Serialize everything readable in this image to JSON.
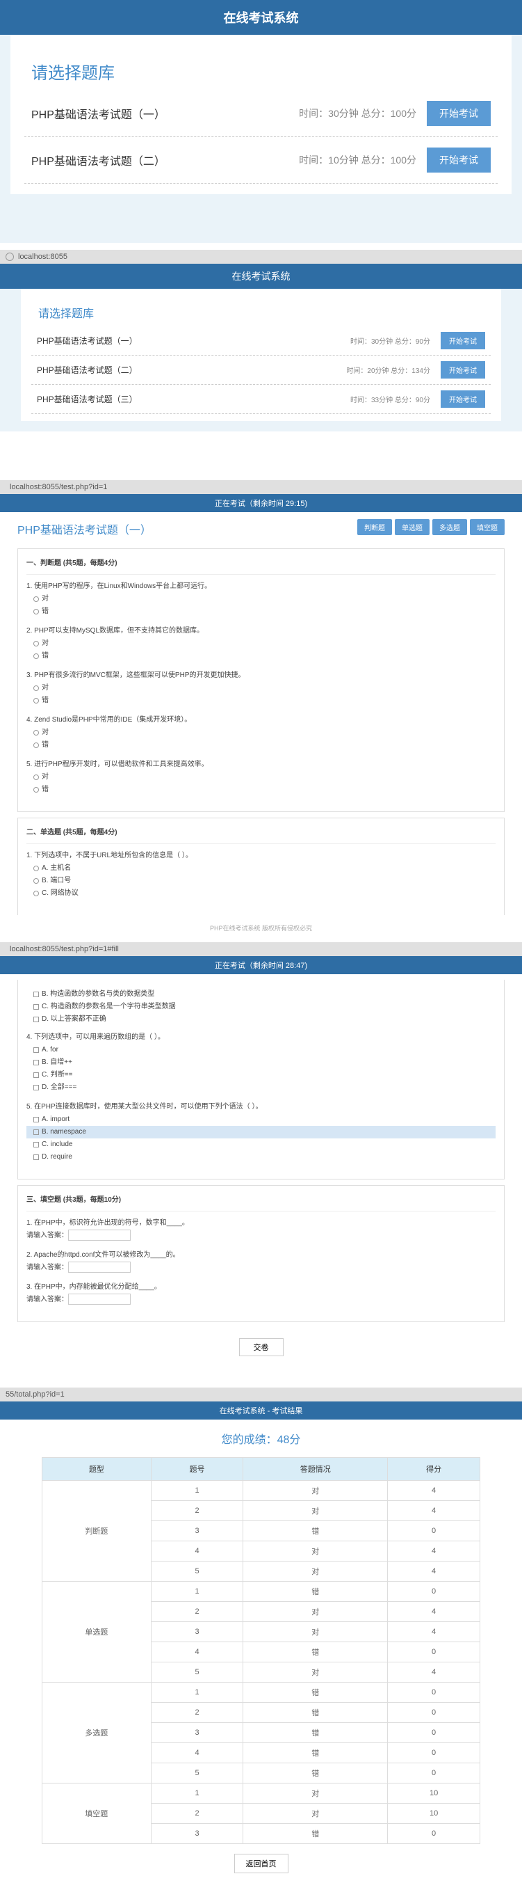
{
  "screen1": {
    "header": "在线考试系统",
    "select_title": "请选择题库",
    "exams": [
      {
        "name": "PHP基础语法考试题（一）",
        "meta": "时间：30分钟 总分：100分",
        "btn": "开始考试"
      },
      {
        "name": "PHP基础语法考试题（二）",
        "meta": "时间：10分钟 总分：100分",
        "btn": "开始考试"
      }
    ]
  },
  "screen2": {
    "url": "localhost:8055",
    "header": "在线考试系统",
    "select_title": "请选择题库",
    "exams": [
      {
        "name": "PHP基础语法考试题（一）",
        "meta": "时间：30分钟 总分：90分",
        "btn": "开始考试"
      },
      {
        "name": "PHP基础语法考试题（二）",
        "meta": "时间：20分钟 总分：134分",
        "btn": "开始考试"
      },
      {
        "name": "PHP基础语法考试题（三）",
        "meta": "时间：33分钟 总分：90分",
        "btn": "开始考试"
      }
    ]
  },
  "screen3": {
    "url": "localhost:8055/test.php?id=1",
    "header": "正在考试（剩余时间 29:15)",
    "title": "PHP基础语法考试题（一）",
    "pills": [
      "判断题",
      "单选题",
      "多选题",
      "填空题"
    ],
    "sec1_title": "一、判断题 (共5题，每题4分)",
    "q1": "1. 使用PHP写的程序，在Linux和Windows平台上都可运行。",
    "q2": "2. PHP可以支持MySQL数据库，但不支持其它的数据库。",
    "q3": "3. PHP有很多流行的MVC框架，这些框架可以使PHP的开发更加快捷。",
    "q4": "4. Zend Studio是PHP中常用的IDE（集成开发环境）。",
    "q5": "5. 进行PHP程序开发时，可以借助软件和工具来提高效率。",
    "opt_yes": "对",
    "opt_no": "错",
    "sec2_title": "二、单选题 (共5题，每题4分)",
    "mq1": "1. 下列选项中，不属于URL地址所包含的信息是（ ）。",
    "mq1_a": "A. 主机名",
    "mq1_b": "B. 端口号",
    "mq1_c": "C. 网络协议"
  },
  "screen4": {
    "url": "localhost:8055/test.php?id=1#fill",
    "header": "正在考试（剩余时间 28:47)",
    "footer_hint": "PHP在线考试系统 版权所有侵权必究",
    "l1": "B. 构造函数的参数名与类的数据类型",
    "l2": "C. 构造函数的参数名是一个字符串类型数据",
    "l3": "D. 以上答案都不正确",
    "mq4": "4. 下列选项中，可以用来遍历数组的是（ ）。",
    "mq4_a": "A. for",
    "mq4_b": "B. 自增++",
    "mq4_c": "C. 判断==",
    "mq4_d": "D. 全部===",
    "mq5": "5. 在PHP连接数据库时，使用某大型公共文件时，可以使用下列个语法（ ）。",
    "mq5_a": "A. import",
    "mq5_b": "B. namespace",
    "mq5_c": "C. include",
    "mq5_d": "D. require",
    "sec3_title": "三、填空题 (共3题，每题10分)",
    "f1": "1. 在PHP中，标识符允许出现的符号，数字和____。",
    "f2": "2. Apache的httpd.conf文件可以被修改为____的。",
    "f3": "3. 在PHP中，内存能被最优化分配给____。",
    "input_label": "请输入答案：",
    "input_label2": "请输入答案：",
    "submit": "交卷"
  },
  "screen5": {
    "url": "55/total.php?id=1",
    "header": "在线考试系统 - 考试结果",
    "score": "您的成绩：48分",
    "th": [
      "题型",
      "题号",
      "答题情况",
      "得分"
    ],
    "types": {
      "t1": "判断题",
      "t2": "单选题",
      "t3": "多选题",
      "t4": "填空题"
    },
    "rows_t1": [
      {
        "n": "1",
        "r": "对",
        "s": "4"
      },
      {
        "n": "2",
        "r": "对",
        "s": "4"
      },
      {
        "n": "3",
        "r": "错",
        "s": "0"
      },
      {
        "n": "4",
        "r": "对",
        "s": "4"
      },
      {
        "n": "5",
        "r": "对",
        "s": "4"
      }
    ],
    "rows_t2": [
      {
        "n": "1",
        "r": "错",
        "s": "0"
      },
      {
        "n": "2",
        "r": "对",
        "s": "4"
      },
      {
        "n": "3",
        "r": "对",
        "s": "4"
      },
      {
        "n": "4",
        "r": "错",
        "s": "0"
      },
      {
        "n": "5",
        "r": "对",
        "s": "4"
      }
    ],
    "rows_t3": [
      {
        "n": "1",
        "r": "错",
        "s": "0"
      },
      {
        "n": "2",
        "r": "错",
        "s": "0"
      },
      {
        "n": "3",
        "r": "错",
        "s": "0"
      },
      {
        "n": "4",
        "r": "错",
        "s": "0"
      },
      {
        "n": "5",
        "r": "错",
        "s": "0"
      }
    ],
    "rows_t4": [
      {
        "n": "1",
        "r": "对",
        "s": "10"
      },
      {
        "n": "2",
        "r": "对",
        "s": "10"
      },
      {
        "n": "3",
        "r": "错",
        "s": "0"
      }
    ],
    "back": "返回首页"
  }
}
